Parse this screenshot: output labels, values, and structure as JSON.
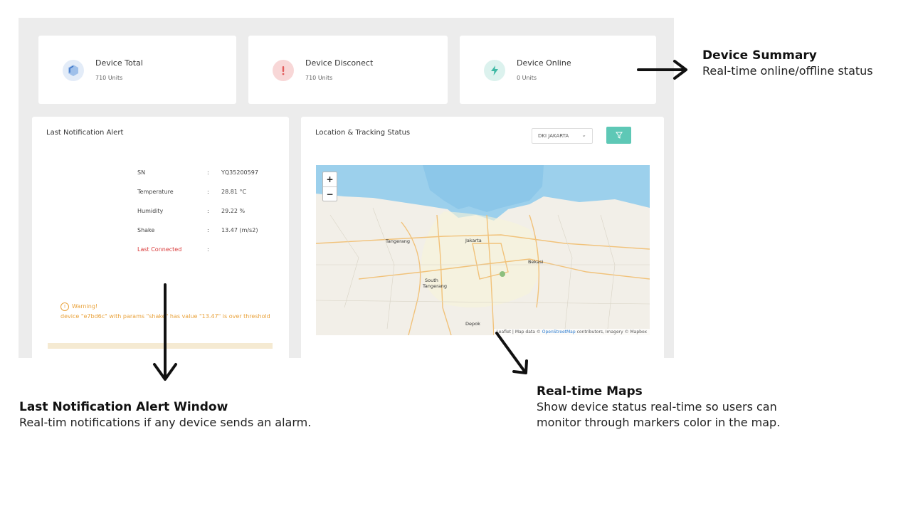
{
  "summary": [
    {
      "title": "Device Total",
      "sub": "710 Units",
      "icon": "cube-icon",
      "color": "#5b8fd6"
    },
    {
      "title": "Device Disconect",
      "sub": "710 Units",
      "icon": "exclamation-icon",
      "color": "#e25c5c"
    },
    {
      "title": "Device Online",
      "sub": "0 Units",
      "icon": "lightning-icon",
      "color": "#3fb9a5"
    }
  ],
  "notification": {
    "title": "Last Notification Alert",
    "rows": [
      {
        "label": "SN",
        "sep": ":",
        "value": "YQ35200597"
      },
      {
        "label": "Temperature",
        "sep": ":",
        "value": "28.81 °C"
      },
      {
        "label": "Humidity",
        "sep": ":",
        "value": "29.22 %"
      },
      {
        "label": "Shake",
        "sep": ":",
        "value": "13.47 (m/s2)"
      },
      {
        "label": "Last Connected",
        "sep": ":",
        "value": ""
      }
    ],
    "warning_head": "Warning!",
    "warning_text": "device \"e7bd6c\" with params \"shake\" has value \"13.47\" is over threshold"
  },
  "location": {
    "title": "Location & Tracking Status",
    "city": "DKI JAKARTA",
    "zoom_in": "+",
    "zoom_out": "−",
    "attrib_a": "Leaflet | Map data © ",
    "attrib_link": "OpenStreetMap",
    "attrib_b": " contributors, Imagery © Mapbox",
    "labels": {
      "tangerang": "Tangerang",
      "jakarta": "Jakarta",
      "bekasi": "Bekasi",
      "south": "South",
      "tangerang2": "Tangerang",
      "depok": "Depok"
    }
  },
  "annotations": {
    "summary_title": "Device Summary",
    "summary_desc": "Real-time online/offline status",
    "alert_title": "Last Notification Alert Window",
    "alert_desc": "Real-tim notifications if any device sends an alarm.",
    "maps_title": "Real-time Maps",
    "maps_desc1": "Show device status real-time so users can",
    "maps_desc2": "monitor through markers color in the map."
  }
}
